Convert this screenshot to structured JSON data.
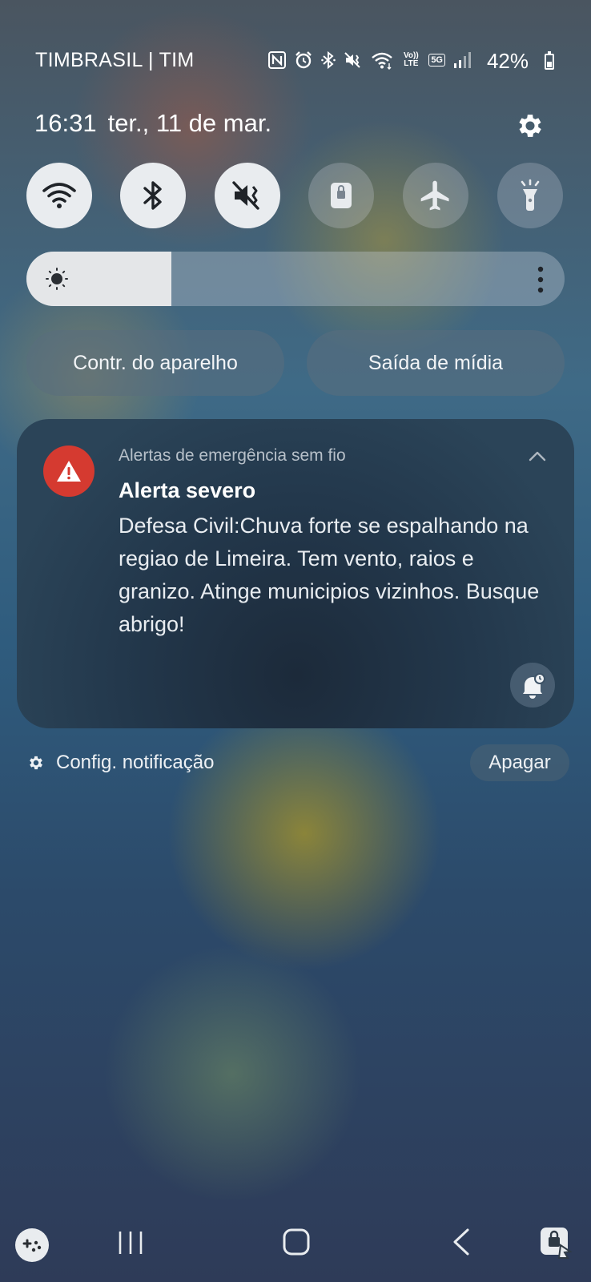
{
  "status_bar": {
    "carrier": "TIMBRASIL | TIM",
    "battery_percent": "42%",
    "battery_level": 0.42,
    "icons": [
      "nfc-icon",
      "alarm-icon",
      "bluetooth-icon",
      "vibrate-mute-icon",
      "wifi-icon",
      "volte-icon",
      "5g-icon",
      "signal-icon"
    ],
    "volte_label": "Vo)) LTE",
    "fiveg_label": "5G"
  },
  "header": {
    "time": "16:31",
    "date": "ter., 11 de mar."
  },
  "quick_toggles": [
    {
      "name": "wifi",
      "icon": "wifi-icon",
      "active": true
    },
    {
      "name": "bluetooth",
      "icon": "bluetooth-icon",
      "active": true
    },
    {
      "name": "sound",
      "icon": "mute-vibrate-icon",
      "active": true
    },
    {
      "name": "screen-lock",
      "icon": "lock-icon",
      "active": false
    },
    {
      "name": "airplane",
      "icon": "airplane-icon",
      "active": false
    },
    {
      "name": "flashlight",
      "icon": "flashlight-icon",
      "active": false
    }
  ],
  "brightness": {
    "level": 0.27
  },
  "buttons": {
    "device_control": "Contr. do aparelho",
    "media_output": "Saída de mídia"
  },
  "notification": {
    "app_name": "Alertas de emergência sem fio",
    "title": "Alerta severo",
    "body": "Defesa Civil:Chuva forte se espalhando na regiao de Limeira. Tem vento, raios e granizo. Atinge municipios vizinhos. Busque abrigo!",
    "accent_color": "#d53a30"
  },
  "footer": {
    "settings_label": "Config. notificação",
    "clear_label": "Apagar"
  },
  "navbar": {
    "items": [
      "game-launcher-icon",
      "recent-apps-icon",
      "home-icon",
      "back-icon",
      "secure-folder-icon"
    ]
  }
}
